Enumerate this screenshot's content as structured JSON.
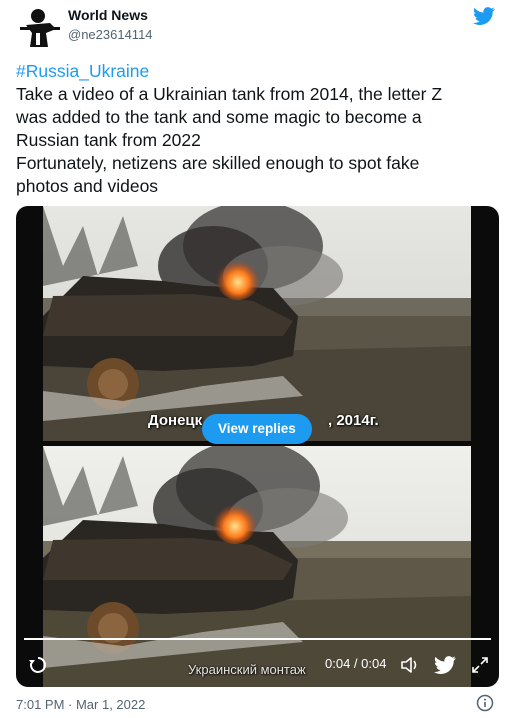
{
  "author": {
    "display_name": "World News",
    "handle": "@ne23614114"
  },
  "tweet": {
    "hashtag": "#Russia_Ukraine",
    "lines": [
      "Take a video of a Ukrainian tank from 2014, the letter Z",
      "was added to the tank and some magic to become a",
      "Russian tank from 2022",
      "Fortunately, netizens are skilled enough to spot fake",
      "photos and videos"
    ]
  },
  "media": {
    "caption_top_left": "Донецк",
    "caption_top_right": ", 2014г.",
    "caption_bottom": "Украинский монтаж",
    "view_replies_label": "View replies",
    "time_display": "0:04 / 0:04",
    "progress_fraction": 1.0
  },
  "footer": {
    "timestamp": "7:01 PM · Mar 1, 2022"
  },
  "icons": {
    "avatar": "avatar-soldier-silhouette",
    "logo": "twitter-bird-icon",
    "replay": "replay-icon",
    "volume": "volume-icon",
    "share": "twitter-bird-icon",
    "fullscreen": "fullscreen-icon",
    "info": "info-icon"
  },
  "colors": {
    "accent": "#1d9bf0",
    "text": "#0f1419",
    "secondary": "#536471",
    "media_bg": "#0b0b0b"
  }
}
